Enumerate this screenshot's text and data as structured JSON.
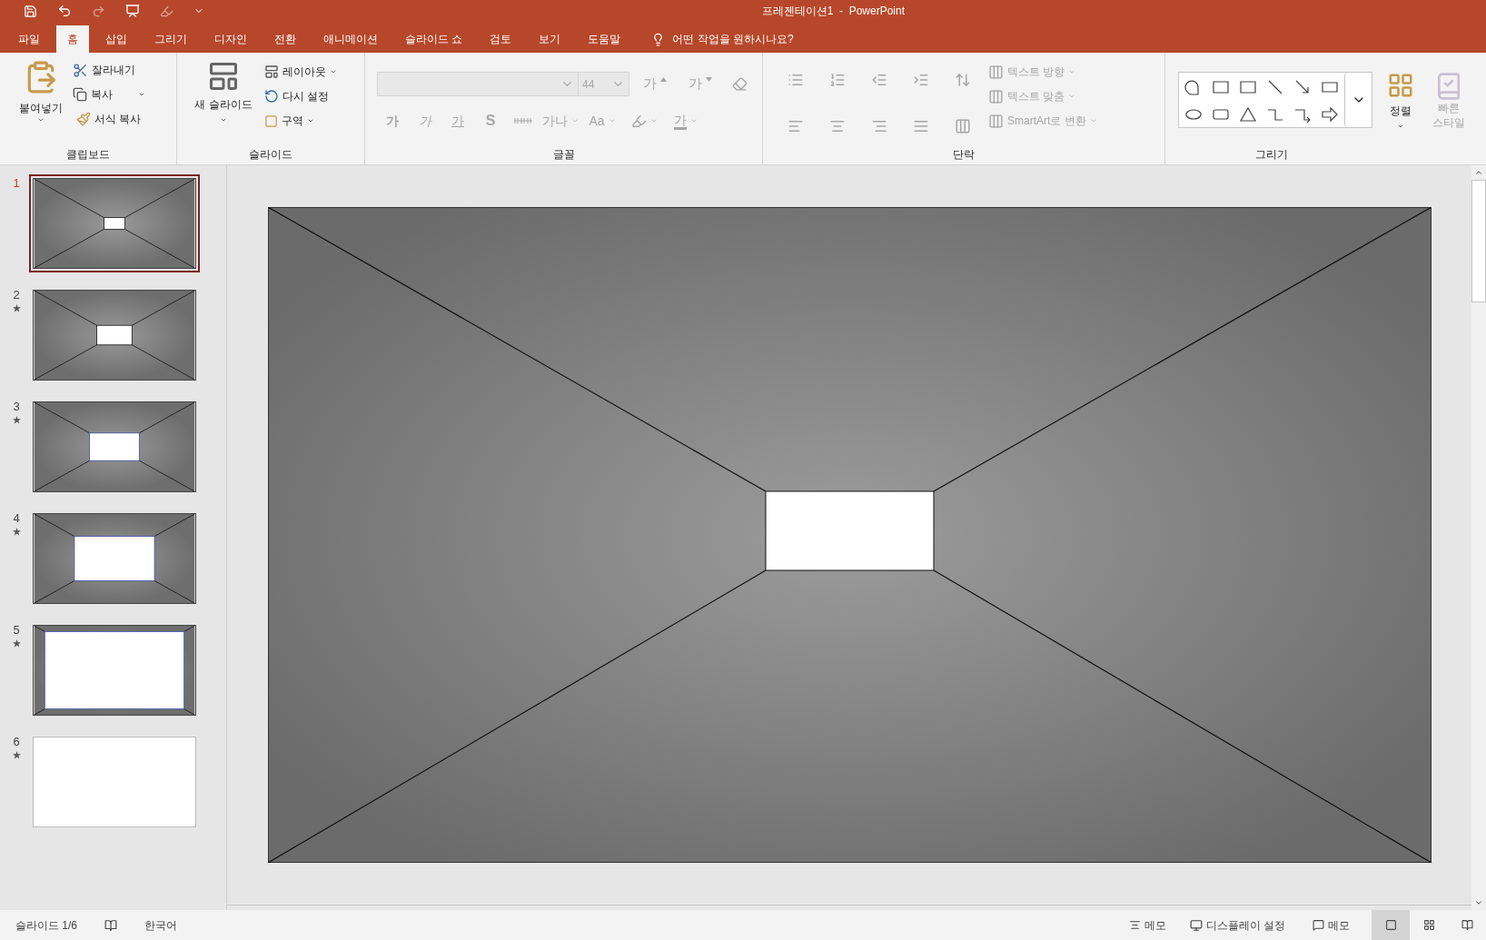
{
  "window": {
    "title": "프레젠테이션1  -  PowerPoint"
  },
  "tabs": [
    {
      "label": "파일",
      "selected": false
    },
    {
      "label": "홈",
      "selected": true
    },
    {
      "label": "삽입",
      "selected": false
    },
    {
      "label": "그리기",
      "selected": false
    },
    {
      "label": "디자인",
      "selected": false
    },
    {
      "label": "전환",
      "selected": false
    },
    {
      "label": "애니메이션",
      "selected": false
    },
    {
      "label": "슬라이드 쇼",
      "selected": false
    },
    {
      "label": "검토",
      "selected": false
    },
    {
      "label": "보기",
      "selected": false
    },
    {
      "label": "도움말",
      "selected": false
    }
  ],
  "tell_me": {
    "label": "어떤 작업을 원하시나요?"
  },
  "clipboard": {
    "label": "클립보드",
    "paste": {
      "label": "붙여넣기"
    },
    "cut": {
      "label": "잘라내기"
    },
    "copy": {
      "label": "복사"
    },
    "format_painter": {
      "label": "서식 복사"
    }
  },
  "slides_group": {
    "label": "슬라이드",
    "new_slide": {
      "label": "새 슬라이드"
    },
    "layout": {
      "label": "레이아웃"
    },
    "reset": {
      "label": "다시 설정"
    },
    "section": {
      "label": "구역"
    }
  },
  "font": {
    "label": "글꼴",
    "size": "44",
    "disabled": true,
    "size_buttons": [
      {
        "label": "가",
        "kind": "grow"
      },
      {
        "label": "가",
        "kind": "shrink"
      }
    ],
    "format_buttons": [
      {
        "label": "가",
        "kind": "bold"
      },
      {
        "label": "가",
        "kind": "italic"
      },
      {
        "label": "가",
        "kind": "underline"
      },
      {
        "label": "S",
        "kind": "shadow"
      },
      {
        "kind": "strike"
      },
      {
        "label": "가나",
        "kind": "spacing"
      },
      {
        "label": "Aa",
        "kind": "case"
      },
      {
        "kind": "highlight"
      },
      {
        "label": "가",
        "kind": "color"
      }
    ]
  },
  "paragraph": {
    "label": "단락",
    "disabled": true,
    "text_buttons": [
      {
        "label": "텍스트 방향"
      },
      {
        "label": "텍스트 맞춤"
      },
      {
        "label": "SmartArt로 변환"
      }
    ]
  },
  "drawing": {
    "label": "그리기",
    "arrange": {
      "label": "정렬",
      "disabled": false
    },
    "quick_styles": {
      "label": "빠른 스타일",
      "disabled": true
    }
  },
  "slides": [
    {
      "number": "1",
      "kind": "tunnel",
      "animated": false,
      "selected": true
    },
    {
      "number": "2",
      "kind": "tunnel",
      "animated": true,
      "selected": false
    },
    {
      "number": "3",
      "kind": "tunnel",
      "animated": true,
      "selected": false
    },
    {
      "number": "4",
      "kind": "tunnel",
      "animated": true,
      "selected": false
    },
    {
      "number": "5",
      "kind": "tunnel",
      "animated": true,
      "selected": false
    },
    {
      "number": "6",
      "kind": "blank",
      "animated": true,
      "selected": false
    }
  ],
  "status_bar": {
    "slide": "슬라이드 1/6",
    "language": "한국어",
    "notes": "메모",
    "display": "디스플레이 설정",
    "comments": "메모",
    "views": [
      {
        "kind": "normal",
        "selected": true
      },
      {
        "kind": "sorter",
        "selected": false
      },
      {
        "kind": "reading",
        "selected": false
      }
    ]
  }
}
